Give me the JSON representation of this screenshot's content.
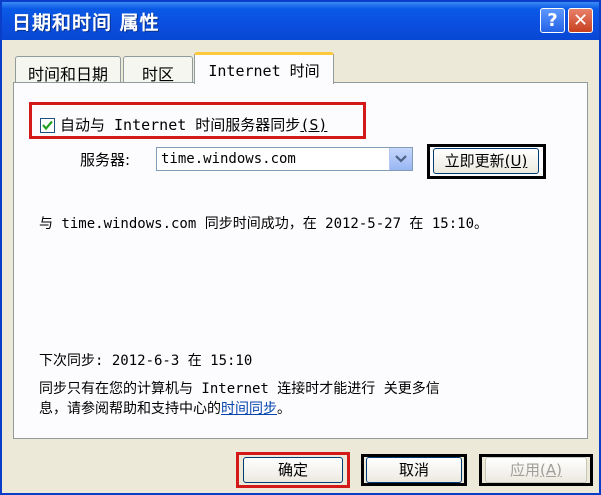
{
  "window": {
    "title": "日期和时间 属性",
    "help_glyph": "?",
    "close_glyph": "✕"
  },
  "tabs": [
    {
      "label": "时间和日期",
      "active": false
    },
    {
      "label": "时区",
      "active": false
    },
    {
      "label": "Internet 时间",
      "active": true
    }
  ],
  "sync": {
    "checked": true,
    "checkbox_label": "自动与 Internet 时间服务器同步",
    "checkbox_hotkey": "(S)",
    "server_label": "服务器:",
    "server_value": "time.windows.com",
    "update_label": "立即更新",
    "update_hotkey": "(U)",
    "status_message": "与 time.windows.com 同步时间成功，在 2012-5-27 在 15:10。",
    "next_sync": "下次同步: 2012-6-3 在 15:10",
    "info_line1": "同步只有在您的计算机与 Internet 连接时才能进行 关更多信",
    "info_line2_prefix": "息，请参阅帮助和支持中心的",
    "info_link": "时间同步",
    "info_line2_suffix": "。"
  },
  "footer": {
    "ok_label": "确定",
    "cancel_label": "取消",
    "apply_label": "应用",
    "apply_hotkey": "(A)"
  },
  "colors": {
    "titlebar": "#0b4fe0",
    "highlight_red": "#d41919",
    "tab_accent": "#ffc83d",
    "face": "#ece9d8"
  }
}
